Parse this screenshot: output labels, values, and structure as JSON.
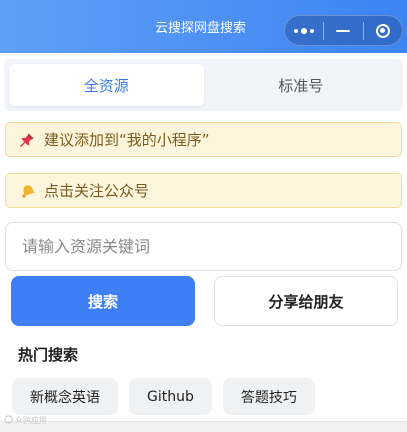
{
  "navbar": {
    "title": "云搜探网盘搜索"
  },
  "tabs": [
    {
      "label": "全资源",
      "active": true
    },
    {
      "label": "标准号",
      "active": false
    }
  ],
  "banners": [
    {
      "icon": "pushpin-icon",
      "text": "建议添加到“我的小程序”"
    },
    {
      "icon": "bell-icon",
      "text": "点击关注公众号"
    }
  ],
  "search": {
    "placeholder": "请输入资源关键词",
    "value": ""
  },
  "buttons": {
    "search_label": "搜索",
    "share_label": "分享给朋友"
  },
  "hot": {
    "title": "热门搜索",
    "items": [
      "新概念英语",
      "Github",
      "答题技巧"
    ]
  },
  "watermark": {
    "text": "众鸥应用"
  },
  "colors": {
    "brand": "#3e7ef7",
    "banner_bg": "#fdf6dd",
    "active_tab_text": "#3b7ae0"
  }
}
